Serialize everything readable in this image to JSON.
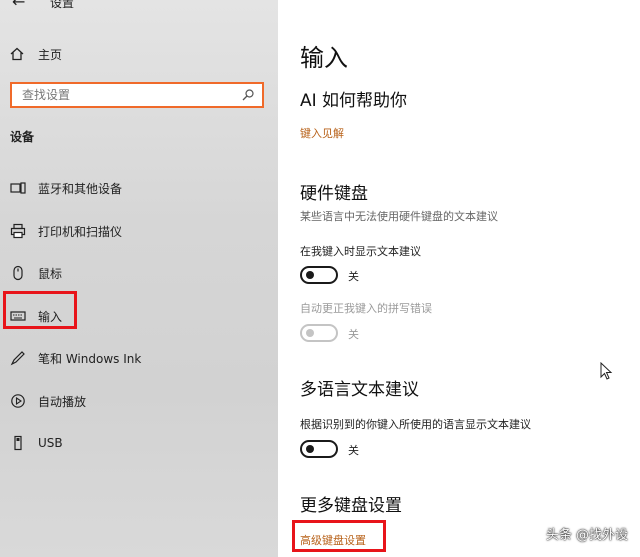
{
  "header": {
    "back_icon": "←",
    "title": "设置"
  },
  "sidebar": {
    "home_label": "主页",
    "search_placeholder": "查找设置",
    "section": "设备",
    "items": [
      {
        "label": "蓝牙和其他设备",
        "icon": "bluetooth-icon"
      },
      {
        "label": "打印机和扫描仪",
        "icon": "printer-icon"
      },
      {
        "label": "鼠标",
        "icon": "mouse-icon"
      },
      {
        "label": "输入",
        "icon": "keyboard-icon"
      },
      {
        "label": "笔和 Windows Ink",
        "icon": "pen-icon"
      },
      {
        "label": "自动播放",
        "icon": "autoplay-icon"
      },
      {
        "label": "USB",
        "icon": "usb-icon"
      }
    ]
  },
  "main": {
    "title": "输入",
    "ai_heading": "AI 如何帮助你",
    "ai_link": "键入见解",
    "hardware_heading": "硬件键盘",
    "hardware_desc": "某些语言中无法使用硬件键盘的文本建议",
    "show_suggestions_label": "在我键入时显示文本建议",
    "show_suggestions_state": "关",
    "autocorrect_label": "自动更正我键入的拼写错误",
    "autocorrect_state": "关",
    "multilang_heading": "多语言文本建议",
    "multilang_label": "根据识别到的你键入所使用的语言显示文本建议",
    "multilang_state": "关",
    "more_heading": "更多键盘设置",
    "advanced_link": "高级键盘设置"
  },
  "watermark": "头条 @找外设",
  "colors": {
    "highlight": "#e8141a",
    "link": "#b8621a",
    "search_border": "#f06a2a"
  }
}
